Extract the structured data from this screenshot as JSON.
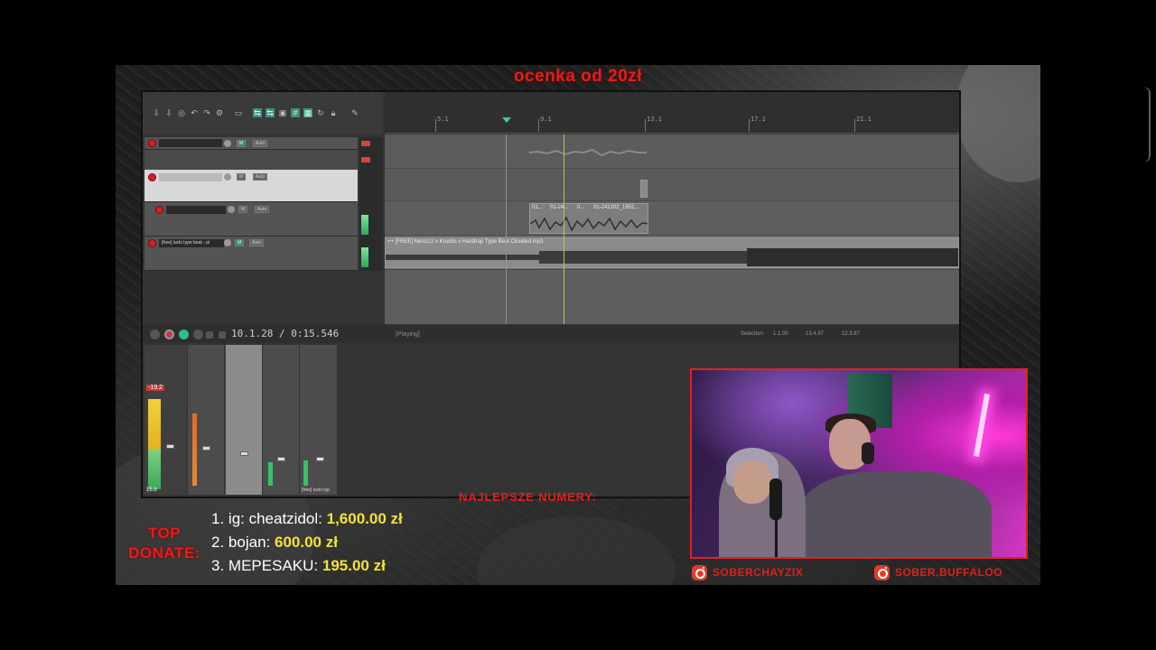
{
  "overlay": {
    "banner": "ocenka od 20zł",
    "best_numbers_title": "NAJLEPSZE NUMERY:",
    "top_donate_line1": "TOP",
    "top_donate_line2": "DONATE:",
    "donors": [
      {
        "rank": "1.",
        "name": "ig: cheatzidol:",
        "amount": "1,600.00 zł"
      },
      {
        "rank": "2.",
        "name": "bojan:",
        "amount": "600.00 zł"
      },
      {
        "rank": "3.",
        "name": "MEPESAKU:",
        "amount": "195.00 zł"
      }
    ],
    "social": [
      {
        "handle": "SOBERCHAYZIX",
        "icon": "instagram-icon"
      },
      {
        "handle": "SOBER.BUFFALOO",
        "icon": "instagram-icon"
      }
    ]
  },
  "daw": {
    "ruler_marks": [
      "5.1",
      "9.1",
      "13.1",
      "17.1",
      "21.1"
    ],
    "tracks": [
      {
        "name": "",
        "buttons": [
          "M",
          "Auto"
        ]
      },
      {
        "name": "",
        "buttons": [
          "M",
          "Auto"
        ]
      },
      {
        "name": "",
        "buttons": [
          "M",
          "Auto"
        ]
      },
      {
        "name": "[free] lucki type beat - pi",
        "buttons": [
          "M",
          "Auto"
        ]
      }
    ],
    "clips": {
      "vocal_clip_labels": [
        "01...",
        "01-24...",
        "0...",
        "01-241202_1952..."
      ],
      "beat_clip_label": "++ [FREE] Nemzzz x Kruubs x Hardtrap Type Beat Clouded.mp3"
    },
    "transport": {
      "time": "10.1.28 / 0:15.546",
      "state": "[Playing]",
      "selection_label": "Selection:",
      "selection_values": [
        "1.1.00",
        "13.4.87",
        "12.3.87"
      ]
    },
    "mixer": {
      "strip_labels": [
        "",
        "",
        "",
        "",
        "[free] lucki typ"
      ],
      "master_value": "-19.2",
      "master_bottom": "15.8"
    }
  }
}
